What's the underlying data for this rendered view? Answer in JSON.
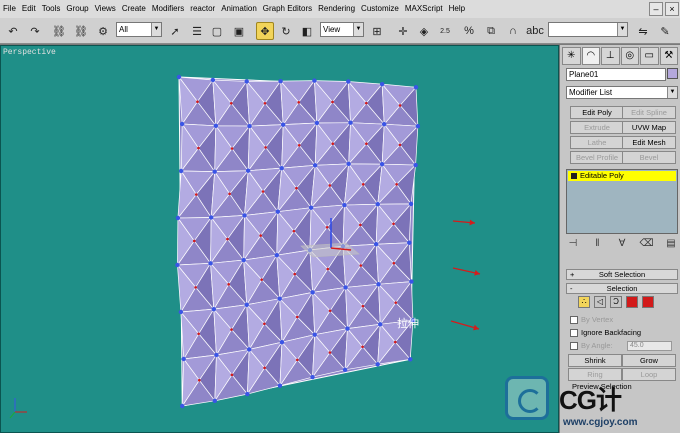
{
  "menu": [
    "File",
    "Edit",
    "Tools",
    "Group",
    "Views",
    "Create",
    "Modifiers",
    "reactor",
    "Animation",
    "Graph Editors",
    "Rendering",
    "Customize",
    "MAXScript",
    "Help"
  ],
  "toolbar": {
    "selection_filter": "All",
    "ref_coord": "View",
    "spinner_snap_value": "2.5"
  },
  "viewport": {
    "label": "Perspective",
    "annotation": "拉伸"
  },
  "command_panel": {
    "object_name": "Plane01",
    "object_color": "#b4a8dc",
    "modifier_list": "Modifier List",
    "modifier_buttons": [
      {
        "label": "Edit Poly",
        "enabled": true
      },
      {
        "label": "Edit Spline",
        "enabled": false
      },
      {
        "label": "Extrude",
        "enabled": false
      },
      {
        "label": "UVW Map",
        "enabled": true
      },
      {
        "label": "Lathe",
        "enabled": false
      },
      {
        "label": "Edit Mesh",
        "enabled": true
      },
      {
        "label": "Bevel Profile",
        "enabled": false
      },
      {
        "label": "Bevel",
        "enabled": false
      }
    ],
    "stack_item": "Editable Poly",
    "rollouts": {
      "soft_selection": {
        "sign": "+",
        "title": "Soft Selection"
      },
      "selection": {
        "sign": "-",
        "title": "Selection"
      }
    },
    "selection": {
      "by_vertex": "By Vertex",
      "ignore_backfacing": "Ignore Backfacing",
      "by_angle": "By Angle:",
      "angle_value": "45.0",
      "shrink": "Shrink",
      "grow": "Grow",
      "ring": "Ring",
      "loop": "Loop",
      "preview_selection": "Preview Selection"
    }
  },
  "watermark": {
    "brand": "CG计",
    "url": "www.cgjoy.com"
  },
  "colors": {
    "viewport_bg": "#1f8f88",
    "mesh_fill": "#8f86c8",
    "vertex": "#3a55e6",
    "arrow": "#d41c1c",
    "highlight": "#f2d45a"
  }
}
